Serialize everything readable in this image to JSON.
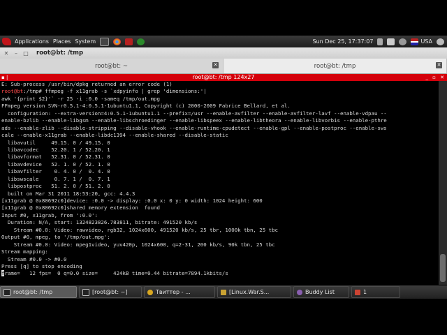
{
  "top_panel": {
    "applications": "Applications",
    "places": "Places",
    "system": "System",
    "datetime": "Sun Dec 25, 17:37:07",
    "keyboard_layout": "USA",
    "icons": [
      "dragon-icon",
      "terminal-launcher-icon",
      "chrome-icon",
      "screenshot-icon",
      "network-icon",
      "speaker-icon",
      "mail-icon",
      "user-icon",
      "flag-icon",
      "power-icon"
    ]
  },
  "window": {
    "title": "root@bt: /tmp",
    "tabs": [
      {
        "label": "root@bt: ~"
      },
      {
        "label": "root@bt: /tmp"
      }
    ],
    "inner_title": "root@bt: /tmp 124x27"
  },
  "terminal": {
    "lines": [
      "E: Sub-process /usr/bin/dpkg returned an error code (1)",
      "root@bt:/tmp# ffmpeg -f x11grab -s `xdpyinfo | grep 'dimensions:'|",
      "awk '{print $2}'` -r 25 -i :0.0 -sameq /tmp/out.mpg",
      "FFmpeg version SVN-r0.5.1-4:0.5.1-1ubuntu1.1, Copyright (c) 2000-2009 Fabrice Bellard, et al.",
      "  configuration: --extra-version=4:0.5.1-1ubuntu1.1 --prefix=/usr --enable-avfilter --enable-avfilter-lavf --enable-vdpau --",
      "enable-bzlib --enable-libgsm --enable-libschroedinger --enable-libspeex --enable-libtheora --enable-libvorbis --enable-pthre",
      "ads --enable-zlib --disable-stripping --disable-vhook --enable-runtime-cpudetect --enable-gpl --enable-postproc --enable-sws",
      "cale --enable-x11grab --enable-libdc1394 --enable-shared --disable-static",
      "  libavutil     49.15. 0 / 49.15. 0",
      "  libavcodec    52.20. 1 / 52.20. 1",
      "  libavformat   52.31. 0 / 52.31. 0",
      "  libavdevice   52. 1. 0 / 52. 1. 0",
      "  libavfilter    0. 4. 0 /  0. 4. 0",
      "  libswscale     0. 7. 1 /  0. 7. 1",
      "  libpostproc   51. 2. 0 / 51. 2. 0",
      "  built on Mar 31 2011 18:53:20, gcc: 4.4.3",
      "[x11grab @ 0x80692c0]device: :0.0 -> display: :0.0 x: 0 y: 0 width: 1024 height: 600",
      "[x11grab @ 0x80692c0]shared memory extension  found",
      "Input #0, x11grab, from ':0.0':",
      "  Duration: N/A, start: 1324823826.783811, bitrate: 491520 kb/s",
      "    Stream #0.0: Video: rawvideo, rgb32, 1024x600, 491520 kb/s, 25 tbr, 1000k tbn, 25 tbc",
      "Output #0, mpeg, to '/tmp/out.mpg':",
      "    Stream #0.0: Video: mpeg1video, yuv420p, 1024x600, q=2-31, 200 kb/s, 90k tbn, 25 tbc",
      "Stream mapping:",
      "  Stream #0.0 -> #0.0",
      "Press [q] to stop encoding",
      "frame=   12 fps=  0 q=0.0 size=     424kB time=0.44 bitrate=7894.1kbits/s"
    ],
    "prompt_user": "root@bt"
  },
  "taskbar": {
    "items": [
      {
        "label": "root@bt: /tmp",
        "active": true,
        "icon": "terminal-icon"
      },
      {
        "label": "[root@bt: ~]",
        "active": false,
        "icon": "terminal-icon"
      },
      {
        "label": "Твиттер - ...",
        "active": false,
        "icon": "chrome-icon"
      },
      {
        "label": "[Linux.War.S...",
        "active": false,
        "icon": "folder-icon"
      },
      {
        "label": "Buddy List",
        "active": false,
        "icon": "pidgin-icon"
      },
      {
        "label": "1",
        "active": false,
        "icon": "window-icon"
      }
    ]
  }
}
